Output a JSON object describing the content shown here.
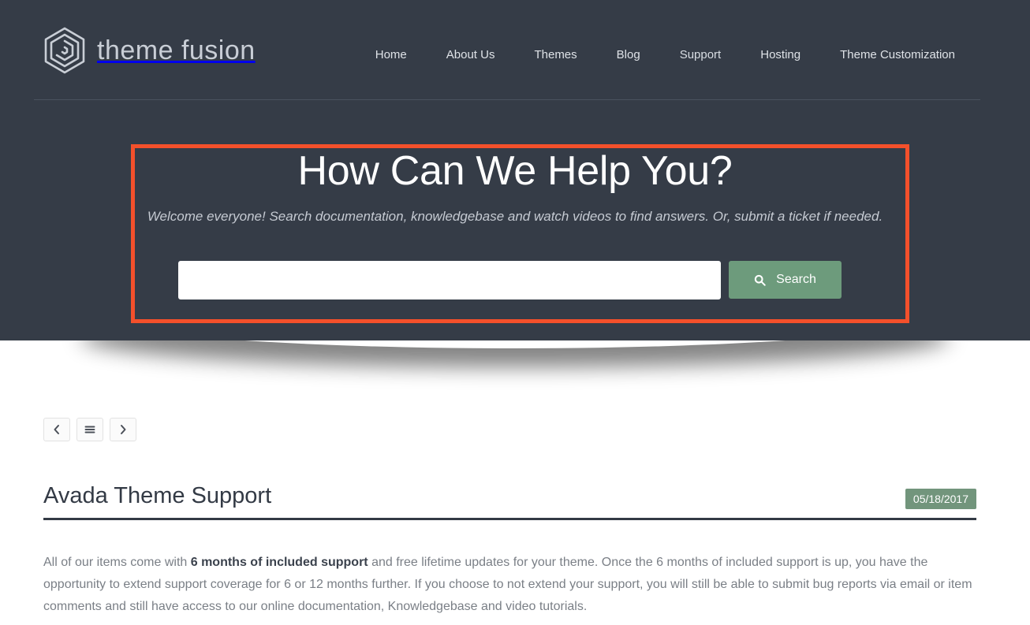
{
  "header": {
    "logo_text": "theme fusion",
    "logo_icon": "hexagon-spiral-logo-icon",
    "nav": [
      {
        "label": "Home",
        "active": false
      },
      {
        "label": "About Us",
        "active": false
      },
      {
        "label": "Themes",
        "active": false
      },
      {
        "label": "Blog",
        "active": false
      },
      {
        "label": "Support",
        "active": true
      },
      {
        "label": "Hosting",
        "active": false
      },
      {
        "label": "Theme Customization",
        "active": false
      }
    ]
  },
  "hero": {
    "title": "How Can We Help You?",
    "subtitle": "Welcome everyone! Search documentation, knowledgebase and watch videos to find answers. Or, submit a ticket if needed.",
    "search": {
      "value": "",
      "placeholder": "",
      "button_label": "Search",
      "button_icon": "search-icon"
    },
    "annotation": {
      "type": "highlight-box",
      "color": "#f4502b"
    }
  },
  "pager": {
    "prev_icon": "chevron-left-icon",
    "list_icon": "list-menu-icon",
    "next_icon": "chevron-right-icon"
  },
  "post": {
    "title": "Avada Theme Support",
    "date": "05/18/2017",
    "body_part1": "All of our items come with ",
    "body_bold": "6 months of included support",
    "body_part2": " and free lifetime updates for your theme. Once the 6 months of included support is up, you have the opportunity to extend support coverage for 6 or 12 months further. If you choose to not extend your support, you will still be able to submit bug reports via email or item comments and still have access to our online documentation, Knowledgebase and video tutorials."
  },
  "colors": {
    "hero_bg": "#353c47",
    "accent_green": "#6d9b7c",
    "badge_green": "#72957c",
    "annotation_red": "#f4502b",
    "heading_dark": "#333a45",
    "body_text": "#7a7f86"
  }
}
